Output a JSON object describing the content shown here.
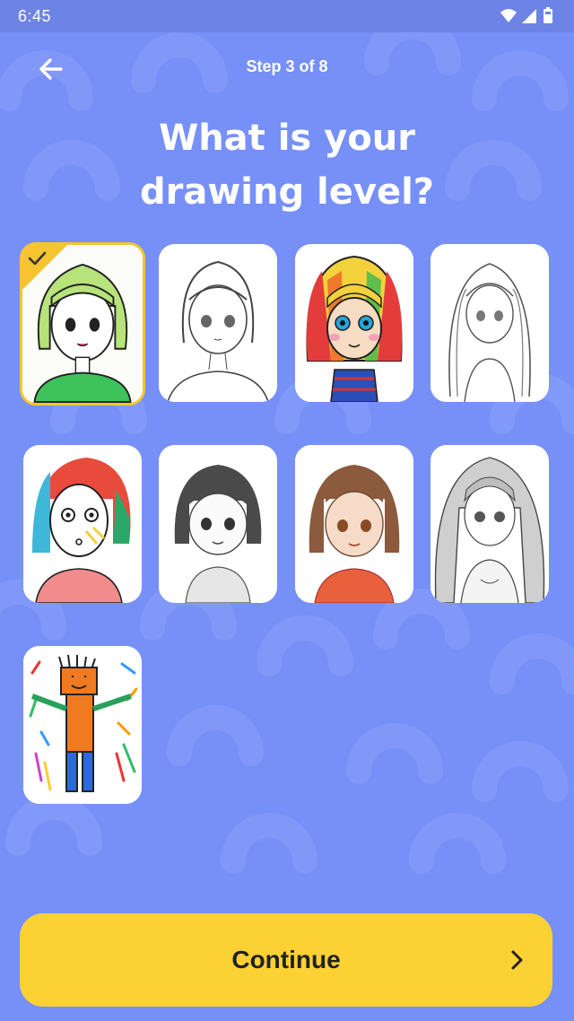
{
  "status_bar": {
    "time": "6:45",
    "icons": [
      "wifi-icon",
      "signal-icon",
      "battery-icon"
    ]
  },
  "header": {
    "back_icon": "arrow-left-icon",
    "step": "Step 3 of 8"
  },
  "title": {
    "line1": "What is your",
    "line2": "drawing level?"
  },
  "levels": [
    {
      "name": "level-option-1",
      "selected": true
    },
    {
      "name": "level-option-2",
      "selected": false
    },
    {
      "name": "level-option-3",
      "selected": false
    },
    {
      "name": "level-option-4",
      "selected": false
    },
    {
      "name": "level-option-5",
      "selected": false
    },
    {
      "name": "level-option-6",
      "selected": false
    },
    {
      "name": "level-option-7",
      "selected": false
    },
    {
      "name": "level-option-8",
      "selected": false
    },
    {
      "name": "level-option-9",
      "selected": false
    }
  ],
  "continue_button": {
    "label": "Continue",
    "icon": "chevron-right-icon"
  },
  "colors": {
    "background": "#7690f7",
    "accent": "#fcd134",
    "selected_border": "#f6c431"
  }
}
